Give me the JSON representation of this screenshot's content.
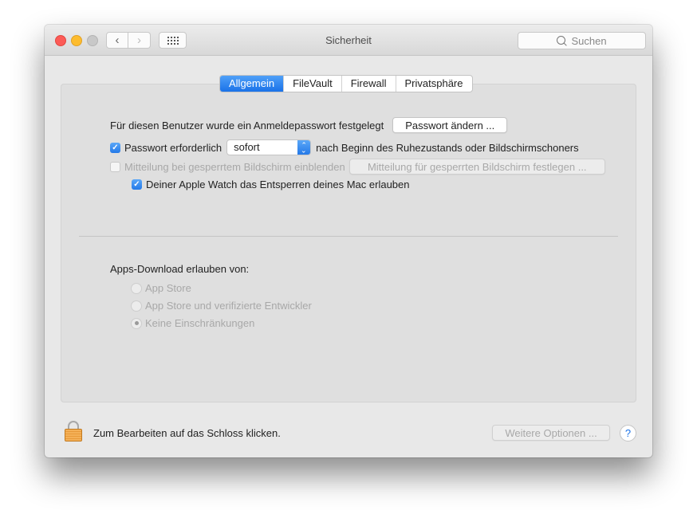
{
  "window": {
    "title": "Sicherheit",
    "search_placeholder": "Suchen",
    "back_icon": "‹",
    "forward_icon": "›"
  },
  "tabs": [
    {
      "label": "Allgemein",
      "active": true
    },
    {
      "label": "FileVault",
      "active": false
    },
    {
      "label": "Firewall",
      "active": false
    },
    {
      "label": "Privatsphäre",
      "active": false
    }
  ],
  "general": {
    "password_set_text": "Für diesen Benutzer wurde ein Anmeldepasswort festgelegt",
    "change_password_button": "Passwort ändern ...",
    "require_password": {
      "label": "Passwort erforderlich",
      "checked": true
    },
    "require_select_value": "sofort",
    "require_suffix": "nach Beginn des Ruhezustands oder Bildschirmschoners",
    "lock_message": {
      "label": "Mitteilung bei gesperrtem Bildschirm einblenden",
      "checked": false,
      "disabled": true
    },
    "lock_message_button": "Mitteilung für gesperrten Bildschirm festlegen ...",
    "apple_watch": {
      "label": "Deiner Apple Watch das Entsperren deines Mac erlauben",
      "checked": true
    }
  },
  "downloads": {
    "heading": "Apps-Download erlauben von:",
    "options": [
      {
        "label": "App Store",
        "selected": false
      },
      {
        "label": "App Store und verifizierte Entwickler",
        "selected": false
      },
      {
        "label": "Keine Einschränkungen",
        "selected": true
      }
    ]
  },
  "footer": {
    "lock_text": "Zum Bearbeiten auf das Schloss klicken.",
    "more_options_button": "Weitere Optionen ...",
    "help_label": "?"
  }
}
